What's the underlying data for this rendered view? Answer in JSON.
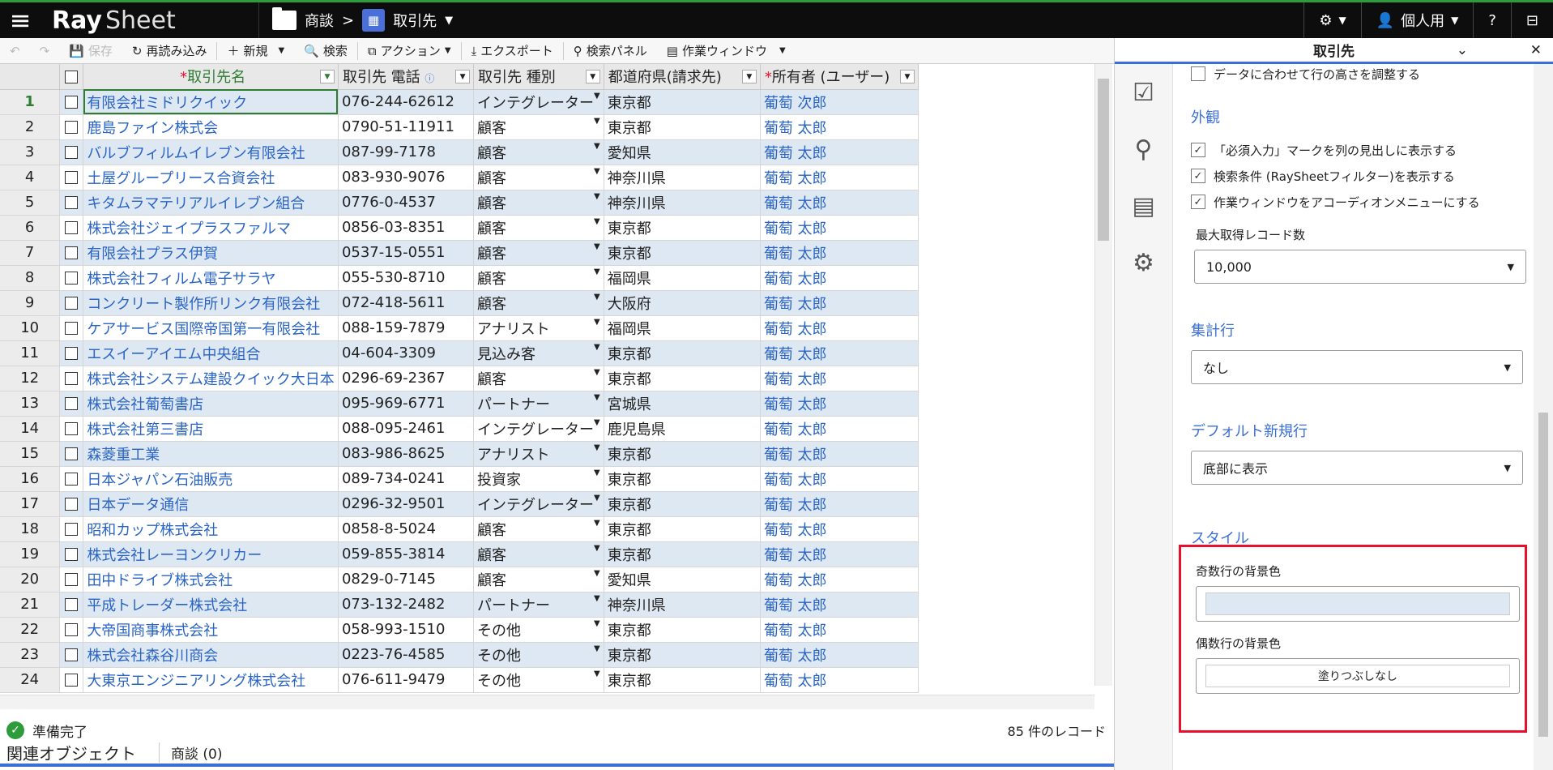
{
  "app": {
    "logo": "Ray",
    "logo_sub": "Sheet"
  },
  "breadcrumb": {
    "parent": "商談",
    "sep": ">",
    "current": "取引先"
  },
  "topbar": {
    "view": "個人用"
  },
  "toolbar": {
    "save": "保存",
    "reload": "再読み込み",
    "new": "新規",
    "search": "検索",
    "action": "アクション",
    "export": "エクスポート",
    "search_panel": "検索パネル",
    "work_window": "作業ウィンドウ"
  },
  "columns": [
    "取引先名",
    "取引先 電話",
    "取引先 種別",
    "都道府県(請求先)",
    "所有者 (ユーザー)"
  ],
  "required_mark": "*",
  "rows": [
    [
      "1",
      "有限会社ミドリクイック",
      "076-244-62612",
      "インテグレーター",
      "東京都",
      "葡萄 次郎"
    ],
    [
      "2",
      "鹿島ファイン株式会",
      "0790-51-11911",
      "顧客",
      "東京都",
      "葡萄 太郎"
    ],
    [
      "3",
      "バルブフィルムイレブン有限会社",
      "087-99-7178",
      "顧客",
      "愛知県",
      "葡萄 太郎"
    ],
    [
      "4",
      "土屋グループリース合資会社",
      "083-930-9076",
      "顧客",
      "神奈川県",
      "葡萄 太郎"
    ],
    [
      "5",
      "キタムラマテリアルイレブン組合",
      "0776-0-4537",
      "顧客",
      "神奈川県",
      "葡萄 太郎"
    ],
    [
      "6",
      "株式会社ジェイプラスファルマ",
      "0856-03-8351",
      "顧客",
      "東京都",
      "葡萄 太郎"
    ],
    [
      "7",
      "有限会社プラス伊賀",
      "0537-15-0551",
      "顧客",
      "東京都",
      "葡萄 太郎"
    ],
    [
      "8",
      "株式会社フィルム電子サラヤ",
      "055-530-8710",
      "顧客",
      "福岡県",
      "葡萄 太郎"
    ],
    [
      "9",
      "コンクリート製作所リンク有限会社",
      "072-418-5611",
      "顧客",
      "大阪府",
      "葡萄 太郎"
    ],
    [
      "10",
      "ケアサービス国際帝国第一有限会社",
      "088-159-7879",
      "アナリスト",
      "福岡県",
      "葡萄 太郎"
    ],
    [
      "11",
      "エスイーアイエム中央組合",
      "04-604-3309",
      "見込み客",
      "東京都",
      "葡萄 太郎"
    ],
    [
      "12",
      "株式会社システム建設クイック大日本",
      "0296-69-2367",
      "顧客",
      "東京都",
      "葡萄 太郎"
    ],
    [
      "13",
      "株式会社葡萄書店",
      "095-969-6771",
      "パートナー",
      "宮城県",
      "葡萄 太郎"
    ],
    [
      "14",
      "株式会社第三書店",
      "088-095-2461",
      "インテグレーター",
      "鹿児島県",
      "葡萄 太郎"
    ],
    [
      "15",
      "森菱重工業",
      "083-986-8625",
      "アナリスト",
      "東京都",
      "葡萄 太郎"
    ],
    [
      "16",
      "日本ジャパン石油販売",
      "089-734-0241",
      "投資家",
      "東京都",
      "葡萄 太郎"
    ],
    [
      "17",
      "日本データ通信",
      "0296-32-9501",
      "インテグレーター",
      "東京都",
      "葡萄 太郎"
    ],
    [
      "18",
      "昭和カップ株式会社",
      "0858-8-5024",
      "顧客",
      "東京都",
      "葡萄 太郎"
    ],
    [
      "19",
      "株式会社レーヨンクリカー",
      "059-855-3814",
      "顧客",
      "東京都",
      "葡萄 太郎"
    ],
    [
      "20",
      "田中ドライブ株式会社",
      "0829-0-7145",
      "顧客",
      "愛知県",
      "葡萄 太郎"
    ],
    [
      "21",
      "平成トレーダー株式会社",
      "073-132-2482",
      "パートナー",
      "神奈川県",
      "葡萄 太郎"
    ],
    [
      "22",
      "大帝国商事株式会社",
      "058-993-1510",
      "その他",
      "東京都",
      "葡萄 太郎"
    ],
    [
      "23",
      "株式会社森谷川商会",
      "0223-76-4585",
      "その他",
      "東京都",
      "葡萄 太郎"
    ],
    [
      "24",
      "大東京エンジニアリング株式会社",
      "076-611-9479",
      "その他",
      "東京都",
      "葡萄 太郎"
    ]
  ],
  "status": {
    "ready": "準備完了",
    "records": "85 件のレコード"
  },
  "related": {
    "title": "関連オブジェクト",
    "tab": "商談 (0)"
  },
  "sidebar": {
    "title": "取引先",
    "opt_row_height": "データに合わせて行の高さを調整する",
    "appearance": "外観",
    "opt_required": "「必須入力」マークを列の見出しに表示する",
    "opt_filter": "検索条件 (RaySheetフィルター)を表示する",
    "opt_accordion": "作業ウィンドウをアコーディオンメニューにする",
    "max_records_label": "最大取得レコード数",
    "max_records": "10,000",
    "summary_label": "集計行",
    "summary_value": "なし",
    "default_new_label": "デフォルト新規行",
    "default_new_value": "底部に表示",
    "style_label": "スタイル",
    "odd_bg_label": "奇数行の背景色",
    "even_bg_label": "偶数行の背景色",
    "even_bg_value": "塗りつぶしなし"
  },
  "colors": {
    "odd_row": "#dde8f3",
    "accent": "#3b6fd8",
    "highlight": "#e8102c",
    "link": "#2a64c5"
  }
}
